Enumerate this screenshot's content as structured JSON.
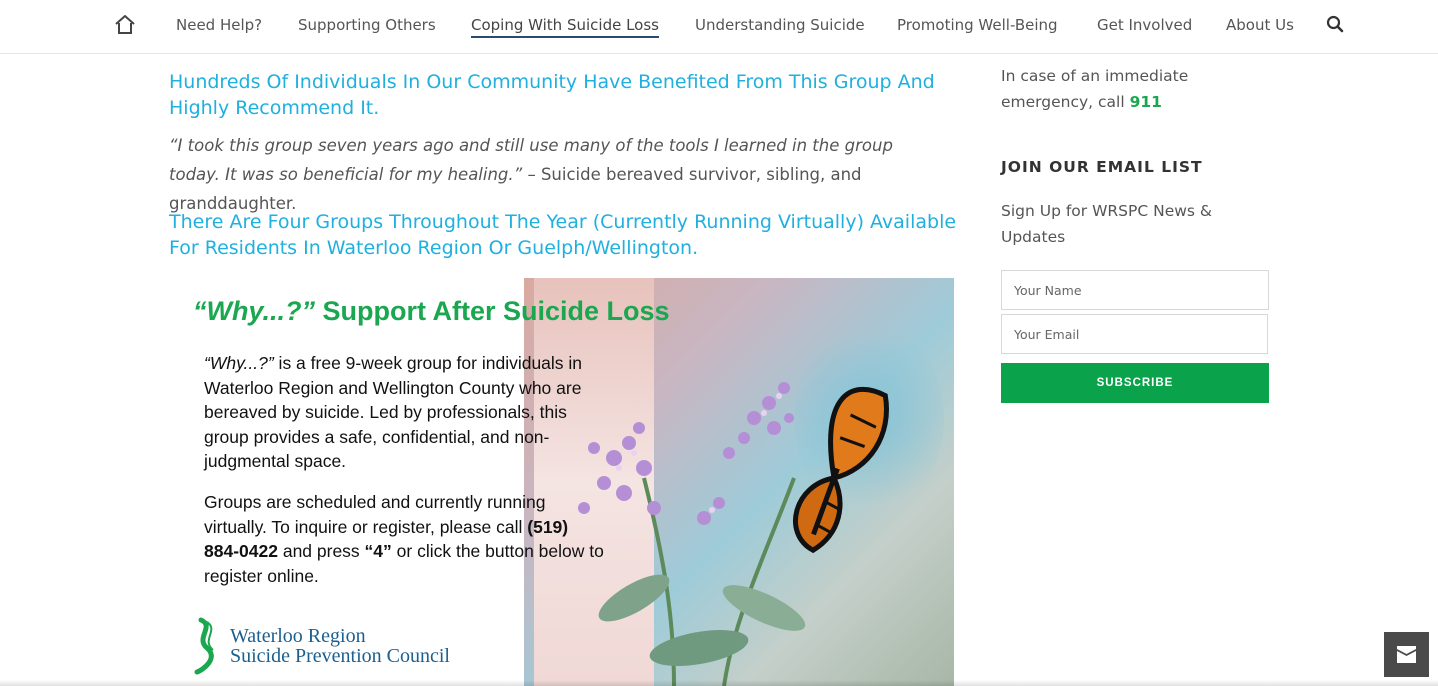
{
  "nav": {
    "items": [
      {
        "label": "Need Help?",
        "active": false
      },
      {
        "label": "Supporting Others",
        "active": false
      },
      {
        "label": "Coping With Suicide Loss",
        "active": true
      },
      {
        "label": "Understanding Suicide",
        "active": false
      },
      {
        "label": "Promoting Well-Being",
        "active": false
      },
      {
        "label": "Get Involved",
        "active": false
      },
      {
        "label": "About Us",
        "active": false
      }
    ],
    "icons": {
      "home": "home-icon",
      "search": "search-icon"
    }
  },
  "main": {
    "heading1": "Hundreds Of Individuals In Our Community Have Benefited From This Group And Highly Recommend It.",
    "quote_text": "“I took this group seven years ago and still use many of the tools I learned in the group today.  It was so beneficial for my healing.”",
    "quote_attribution": " – Suicide bereaved survivor, sibling, and granddaughter.",
    "heading2": "There Are Four Groups Throughout The Year (Currently Running Virtually) Available For Residents In Waterloo Region Or Guelph/Wellington."
  },
  "promo": {
    "title_quote": "“Why...?”",
    "title_rest": " Support After Suicide Loss",
    "p1_quote": "“Why...?”",
    "p1_rest": " is a free 9-week group for individuals in Waterloo Region and Wellington County who are bereaved by suicide. Led by professionals, this group provides a safe, confidential, and non-judgmental space.",
    "p2_a": "Groups are scheduled and currently running virtually. To inquire or register, please call ",
    "p2_phone": "(519) 884-0422",
    "p2_b": " and press ",
    "p2_key": "“4”",
    "p2_c": " or click the button below to register online.",
    "logo_line1": "Waterloo Region",
    "logo_line2": "Suicide Prevention Council"
  },
  "sidebar": {
    "emergency_text": "In case of an immediate emergency, call ",
    "emergency_number": "911",
    "join_title": "JOIN OUR EMAIL LIST",
    "signup_text": "Sign Up for WRSPC News & Updates",
    "name_placeholder": "Your Name",
    "email_placeholder": "Your Email",
    "subscribe_label": "SUBSCRIBE"
  },
  "colors": {
    "accent_blue": "#1fb0e0",
    "brand_green": "#1aa750",
    "button_green": "#0aa34b",
    "nav_active_underline": "#2a4a72"
  },
  "contact_button_icon": "envelope-icon"
}
